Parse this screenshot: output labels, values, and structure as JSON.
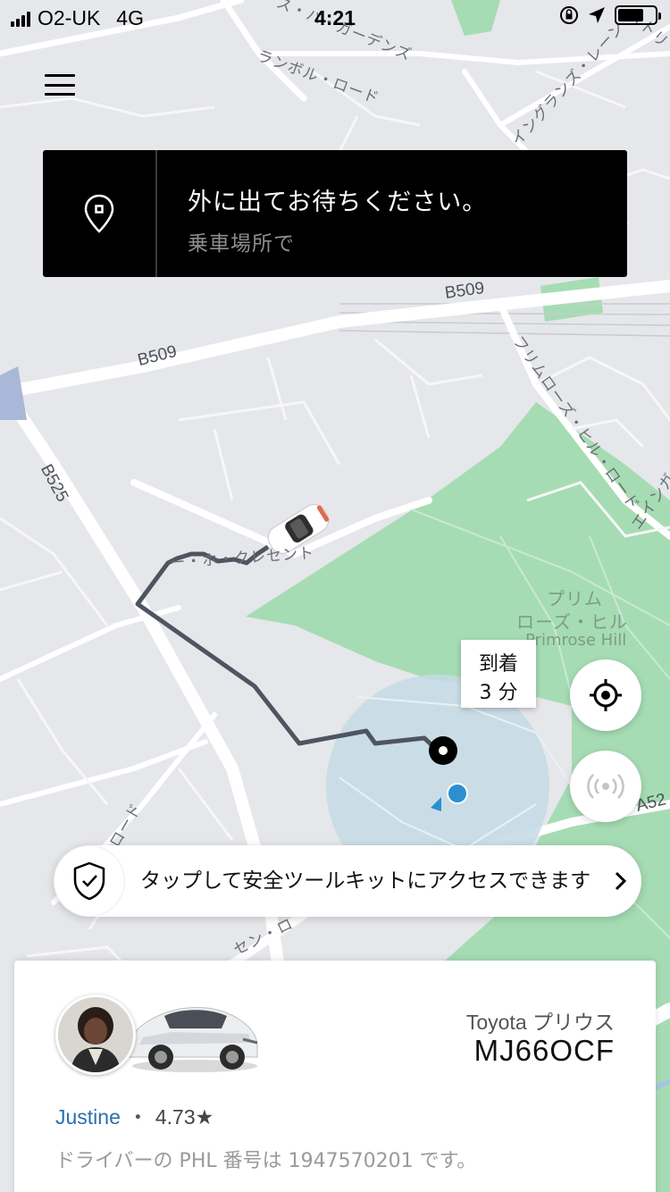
{
  "status_bar": {
    "carrier": "O2-UK",
    "network": "4G",
    "time": "4:21"
  },
  "map": {
    "labels": {
      "top_gardens": "ス・パ・ガーデンズ",
      "ranbol_road": "ランボル・ロード",
      "inglands_lane": "イングランズ・レーン",
      "strip_top_right": "ストリ",
      "b509_right": "B509",
      "b509_left": "B509",
      "primrose_hill_road": "フリムローズ・ヒル・ロード",
      "ainger": "エインガー",
      "b525": "B525",
      "crescent": "ー・ホ・クレセント",
      "primrose_jp_1": "プリム",
      "primrose_jp_2": "ローズ・ヒル",
      "primrose_en": "Primrose Hill",
      "a52": "A52",
      "road_left": "ロード",
      "road_bottom": "セン・ロ"
    }
  },
  "banner": {
    "title": "外に出てお待ちください。",
    "subtitle": "乗車場所で",
    "icon": "location-pin-icon"
  },
  "eta": {
    "label": "到着",
    "value": "3 分"
  },
  "buttons": {
    "recenter_icon": "crosshair-icon",
    "share_icon": "broadcast-icon"
  },
  "safety": {
    "text": "タップして安全ツールキットにアクセスできます",
    "icon": "shield-check-icon"
  },
  "driver": {
    "vehicle_model": "Toyota プリウス",
    "plate": "MJ66OCF",
    "name": "Justine",
    "separator": "・",
    "rating": "4.73★",
    "phl_text": "ドライバーの PHL 番号は 1947570201 です。"
  },
  "colors": {
    "map_bg": "#e6e7ea",
    "park": "#a6dcb4",
    "route": "#4f5560",
    "pickup_zone": "#c4dbe6",
    "user_dot": "#2b8fd0",
    "driver_name": "#2a6fb0"
  }
}
